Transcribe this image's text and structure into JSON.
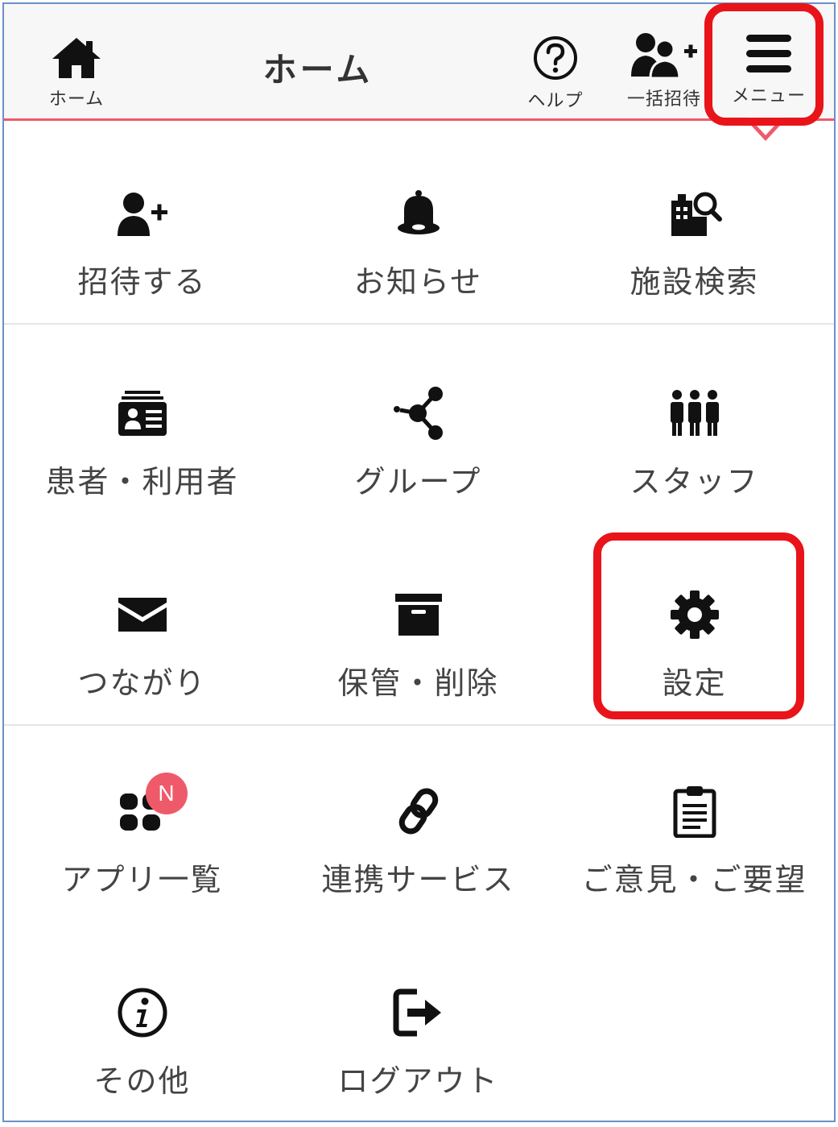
{
  "header": {
    "title": "ホーム",
    "home_label": "ホーム",
    "help_label": "ヘルプ",
    "bulk_invite_label": "一括招待",
    "menu_label": "メニュー"
  },
  "menu": {
    "items": [
      {
        "label": "招待する",
        "icon": "add-user-icon"
      },
      {
        "label": "お知らせ",
        "icon": "bell-icon"
      },
      {
        "label": "施設検索",
        "icon": "facility-search-icon"
      },
      {
        "label": "患者・利用者",
        "icon": "id-card-icon"
      },
      {
        "label": "グループ",
        "icon": "share-nodes-icon"
      },
      {
        "label": "スタッフ",
        "icon": "staff-people-icon"
      },
      {
        "label": "つながり",
        "icon": "envelope-icon"
      },
      {
        "label": "保管・削除",
        "icon": "archive-box-icon"
      },
      {
        "label": "設定",
        "icon": "gear-icon"
      },
      {
        "label": "アプリ一覧",
        "icon": "apps-grid-icon",
        "badge": "N"
      },
      {
        "label": "連携サービス",
        "icon": "link-icon"
      },
      {
        "label": "ご意見・ご要望",
        "icon": "clipboard-icon"
      },
      {
        "label": "その他",
        "icon": "info-icon"
      },
      {
        "label": "ログアウト",
        "icon": "logout-icon"
      }
    ]
  },
  "colors": {
    "accent_line": "#ef5a6a",
    "badge": "#ef5a6a",
    "highlight": "#e8141a",
    "icon": "#1a1a1a"
  }
}
